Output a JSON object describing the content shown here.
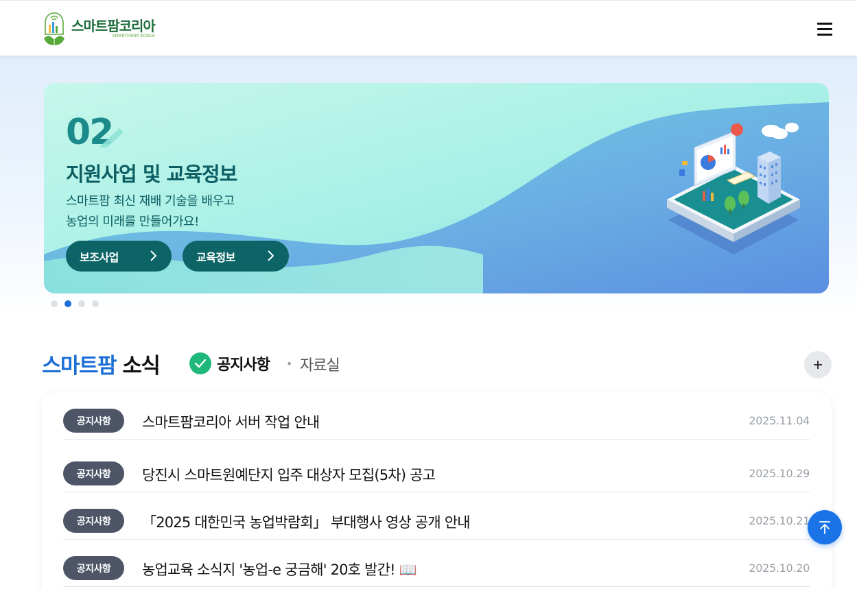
{
  "header": {
    "logo_text": "스마트팜코리아",
    "logo_sub": "SMARTFARM KOREA",
    "menu_icon": "hamburger-icon"
  },
  "banner": {
    "number": "02",
    "title": "지원사업 및 교육정보",
    "desc_line1": "스마트팜 최신 재배 기술을 배우고",
    "desc_line2": "농업의 미래를 만들어가요!",
    "btn_support": "보조사업",
    "btn_edu": "교육정보",
    "slides": 4,
    "active_slide": 2,
    "colors": {
      "start": "#c8f5ea",
      "end": "#5b8fe0",
      "button": "#0d6466",
      "text": "#0c5e63"
    }
  },
  "news": {
    "title_accent": "스마트팜",
    "title_rest": " 소식",
    "tab_notice": "공지사항",
    "tab_sep": "•",
    "tab_archive": "자료실",
    "plus_icon": "plus-icon",
    "items": [
      {
        "badge": "공지사항",
        "title": "스마트팜코리아 서버 작업 안내",
        "date": "2025.11.04"
      },
      {
        "badge": "공지사항",
        "title": "당진시 스마트원예단지 입주 대상자 모집(5차) 공고",
        "date": "2025.10.29"
      },
      {
        "badge": "공지사항",
        "title": "「2025 대한민국 농업박람회」 부대행사 영상 공개 안내",
        "date": "2025.10.21"
      },
      {
        "badge": "공지사항",
        "title": "농업교육 소식지 '농업-e 궁금해' 20호 발간! 📖",
        "date": "2025.10.20"
      }
    ]
  },
  "colors": {
    "accent": "#1b6fd6",
    "check": "#1fb87a",
    "badge": "#4d5567",
    "top_button": "#1b73e8"
  }
}
